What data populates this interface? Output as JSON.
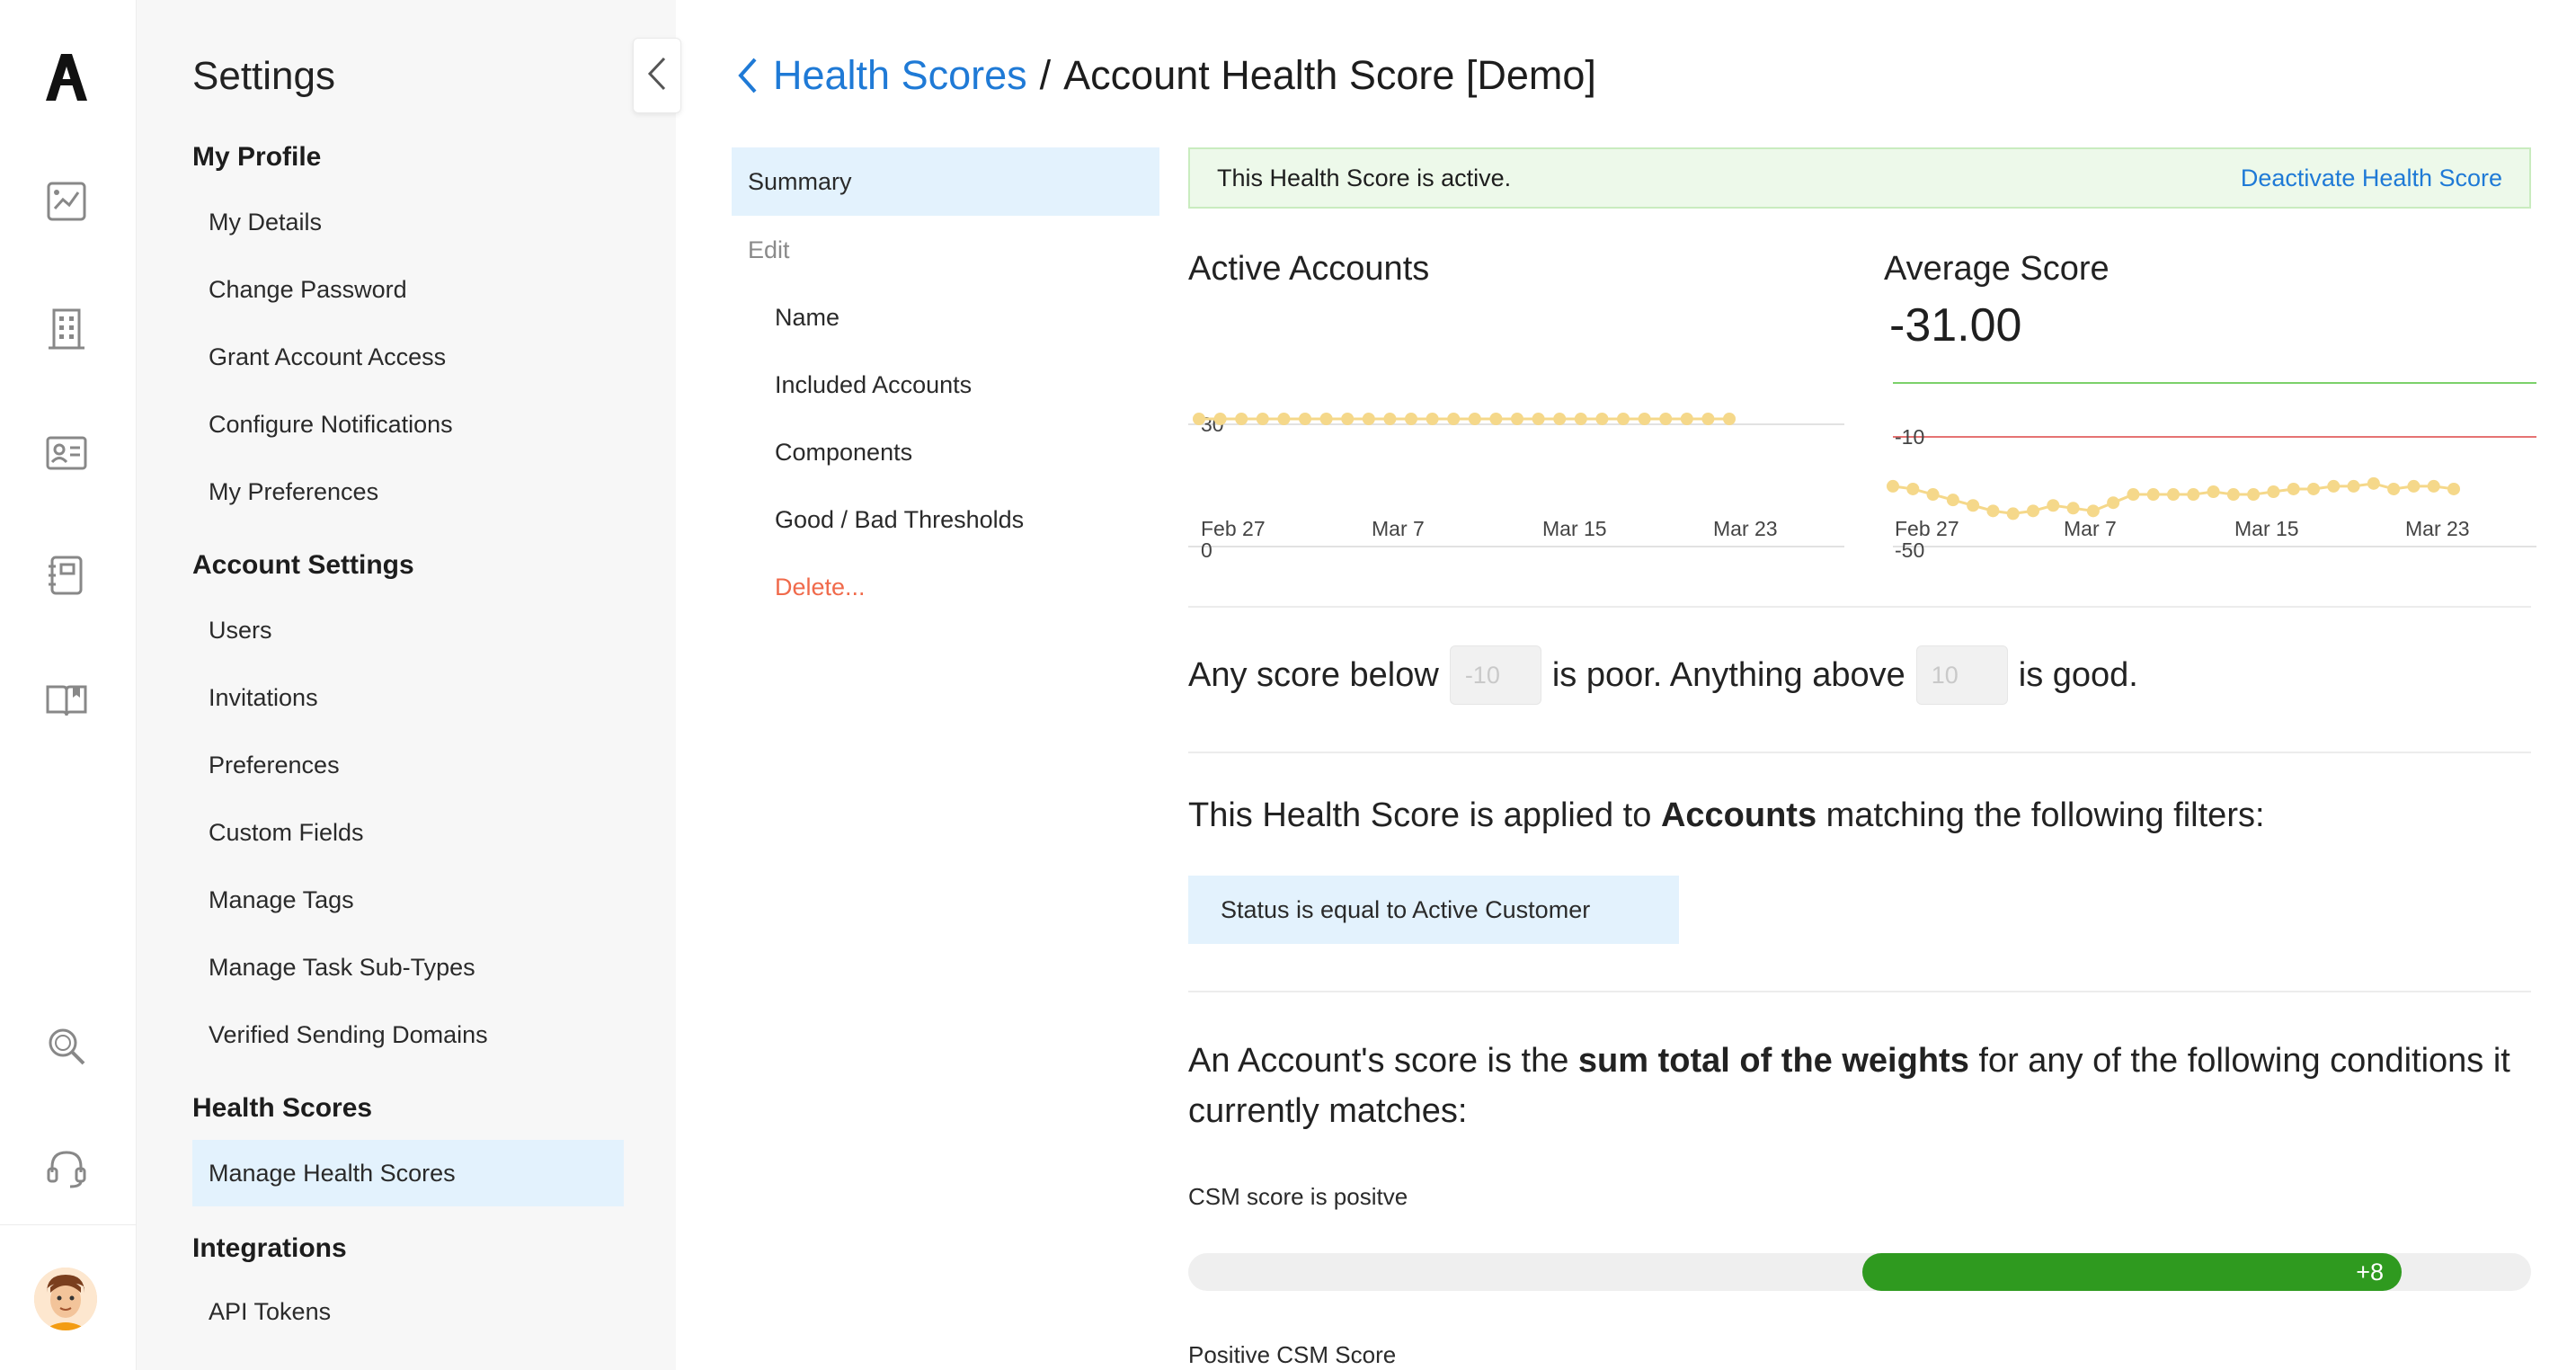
{
  "rail": {
    "logo": "A",
    "icons": [
      "chart-icon",
      "building-icon",
      "contact-card-icon",
      "notebook-icon",
      "book-icon",
      "search-icon",
      "headset-icon"
    ]
  },
  "settings": {
    "title": "Settings",
    "sections": [
      {
        "heading": "My Profile",
        "items": [
          "My Details",
          "Change Password",
          "Grant Account Access",
          "Configure Notifications",
          "My Preferences"
        ]
      },
      {
        "heading": "Account Settings",
        "items": [
          "Users",
          "Invitations",
          "Preferences",
          "Custom Fields",
          "Manage Tags",
          "Manage Task Sub-Types",
          "Verified Sending Domains"
        ]
      },
      {
        "heading": "Health Scores",
        "items": [
          "Manage Health Scores"
        ]
      },
      {
        "heading": "Integrations",
        "items": [
          "API Tokens"
        ]
      }
    ],
    "active_item": "Manage Health Scores"
  },
  "breadcrumb": {
    "parent": "Health Scores",
    "separator": "/",
    "current": "Account Health Score [Demo]"
  },
  "subnav": {
    "summary": "Summary",
    "edit": "Edit",
    "name": "Name",
    "included_accounts": "Included Accounts",
    "components": "Components",
    "thresholds": "Good / Bad Thresholds",
    "delete": "Delete..."
  },
  "banner": {
    "text": "This Health Score is active.",
    "action": "Deactivate Health Score",
    "color": "#edf9ea"
  },
  "active_accounts": {
    "title": "Active Accounts",
    "tick_top": "30",
    "tick_bottom": "0"
  },
  "average_score": {
    "title": "Average Score",
    "value": "-31.00",
    "tick_top": "-10",
    "tick_bottom": "-50"
  },
  "chart_data": [
    {
      "type": "line",
      "title": "Active Accounts",
      "x_ticks": [
        "Feb 27",
        "Mar 7",
        "Mar 15",
        "Mar 23"
      ],
      "y_ticks": [
        "30",
        "0"
      ],
      "ylim": [
        0,
        30
      ],
      "series": [
        {
          "values": [
            30,
            30,
            30,
            30,
            30,
            30,
            30,
            30,
            30,
            30,
            30,
            30,
            30,
            30,
            30,
            30,
            30,
            30,
            30,
            30,
            30,
            30,
            30,
            30,
            30,
            30
          ]
        }
      ],
      "color": "#f5d88a"
    },
    {
      "type": "line",
      "title": "Average Score",
      "x_ticks": [
        "Feb 27",
        "Mar 7",
        "Mar 15",
        "Mar 23"
      ],
      "y_ticks": [
        "-10",
        "-50"
      ],
      "ylim": [
        -50,
        -10
      ],
      "reference_lines": [
        {
          "value": -10,
          "color": "#e57373"
        },
        {
          "value": 10,
          "color": "#7bd16a"
        }
      ],
      "series": [
        {
          "values": [
            -28,
            -29,
            -31,
            -33,
            -35,
            -37,
            -38,
            -37,
            -35,
            -36,
            -37,
            -34,
            -31,
            -31,
            -31,
            -31,
            -30,
            -31,
            -31,
            -30,
            -29,
            -29,
            -28,
            -28,
            -27,
            -29,
            -28,
            -28,
            -29
          ]
        }
      ],
      "color": "#f5d88a"
    }
  ],
  "thresholds": {
    "prefix": "Any score below",
    "poor_value": "-10",
    "middle": "is poor. Anything above",
    "good_value": "10",
    "suffix": "is good."
  },
  "applied": {
    "prefix": "This Health Score is applied to ",
    "entity": "Accounts",
    "suffix": " matching the following filters:",
    "filter": "Status is equal to Active Customer"
  },
  "sum": {
    "prefix": "An Account's score is the ",
    "bold": "sum total of the weights",
    "suffix": " for any of the following conditions it currently matches:"
  },
  "conditions": [
    {
      "label": "CSM score is positve",
      "weight": "+8",
      "weight_value": 8,
      "color": "#2f9a1f"
    },
    {
      "label": "Positive CSM Score"
    }
  ]
}
